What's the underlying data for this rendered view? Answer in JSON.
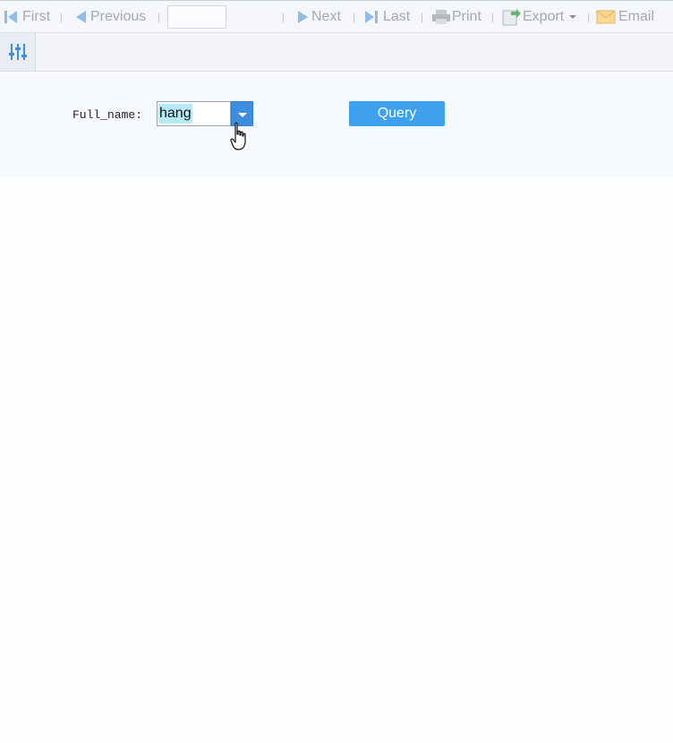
{
  "toolbar": {
    "first_label": "First",
    "previous_label": "Previous",
    "page_input_value": "",
    "next_label": "Next",
    "last_label": "Last",
    "print_label": "Print",
    "export_label": "Export",
    "email_label": "Email"
  },
  "icons": {
    "first": "first-page-icon",
    "previous": "previous-page-icon",
    "next": "next-page-icon",
    "last": "last-page-icon",
    "print": "printer-icon",
    "export": "export-icon",
    "email": "envelope-icon",
    "filter": "sliders-icon",
    "cursor": "hand-pointer-icon"
  },
  "params": {
    "full_name_label": "Full_name:",
    "full_name_value": "hang",
    "query_label": "Query"
  },
  "colors": {
    "accent": "#3ea1ef",
    "dropdown_button": "#3e8ee0",
    "selection_highlight": "#b7eaf7",
    "nav_icon": "#8fbde8",
    "export_icon": "#5fb86a",
    "email_icon": "#f2c66a",
    "toolbar_text": "#a3a9b2"
  }
}
